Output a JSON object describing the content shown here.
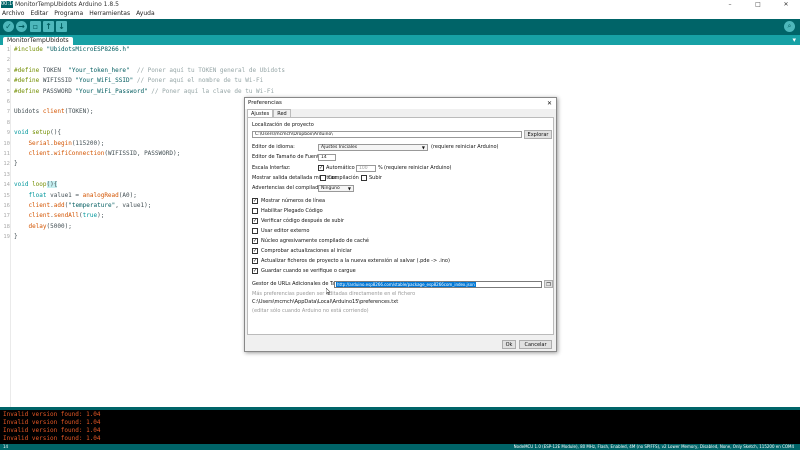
{
  "window": {
    "app_badge": "00:16",
    "title": "MonitorTempUbidots Arduino 1.8.5",
    "min_glyph": "–",
    "max_glyph": "□",
    "close_glyph": "✕"
  },
  "menu": [
    "Archivo",
    "Editar",
    "Programa",
    "Herramientas",
    "Ayuda"
  ],
  "toolbar": {
    "verify_icon": "check-icon",
    "upload_icon": "arrow-right-icon",
    "new_icon": "new-file-icon",
    "open_icon": "open-icon",
    "save_icon": "save-icon",
    "serial_icon": "magnifier-icon"
  },
  "tab": {
    "label": "MonitorTempUbidots",
    "menu_glyph": "▾"
  },
  "code": {
    "l1a": "#include ",
    "l1b": "\"UbidotsMicroESP8266.h\"",
    "l3a": "#define ",
    "l3b": "TOKEN  ",
    "l3c": "\"Your_token_here\"",
    "l3d": "  // Poner aquí tu TOKEN general de Ubidots",
    "l4a": "#define ",
    "l4b": "WIFISSID ",
    "l4c": "\"Your_WiFi_SSID\"",
    "l4d": " // Poner aquí el nombre de tu Wi-Fi",
    "l5a": "#define ",
    "l5b": "PASSWORD ",
    "l5c": "\"Your_WiFi_Password\"",
    "l5d": " // Poner aquí la clave de tu Wi-Fi",
    "l7a": "Ubidots ",
    "l7b": "client",
    "l7c": "(TOKEN);",
    "l9a": "void ",
    "l9b": "setup",
    "l9c": "(){",
    "l10a": "    Serial",
    "l10b": ".",
    "l10c": "begin",
    "l10d": "(115200);",
    "l11a": "    client",
    "l11b": ".",
    "l11c": "wifiConnection",
    "l11d": "(WIFISSID, PASSWORD);",
    "l12": "}",
    "l14a": "void ",
    "l14b": "loop",
    "l14c": "(){",
    "l15a": "    float ",
    "l15b": "value1 = ",
    "l15c": "analogRead",
    "l15d": "(A0);",
    "l16a": "    client",
    "l16b": ".",
    "l16c": "add",
    "l16d": "(",
    "l16e": "\"temperature\"",
    "l16f": ", value1);",
    "l17a": "    client",
    "l17b": ".",
    "l17c": "sendAll",
    "l17d": "(",
    "l17e": "true",
    "l17f": ");",
    "l18a": "    ",
    "l18b": "delay",
    "l18c": "(5000);",
    "l19": "}",
    "line_numbers": [
      "1",
      "2",
      "3",
      "4",
      "5",
      "6",
      "7",
      "8",
      "9",
      "10",
      "11",
      "12",
      "13",
      "14",
      "15",
      "16",
      "17",
      "18",
      "19"
    ]
  },
  "console": {
    "lines": [
      "Invalid version found: 1.04",
      "Invalid version found: 1.04",
      "Invalid version found: 1.04",
      "Invalid version found: 1.04"
    ]
  },
  "status": {
    "line": "14",
    "board": "NodeMCU 1.0 (ESP-12E Module), 80 MHz, Flash, Enabled, 4M (no SPIFFS), v2 Lower Memory, Disabled, None, Only Sketch, 115200 en COM4"
  },
  "dialog": {
    "title": "Preferencias",
    "close_glyph": "✕",
    "tabs": [
      "Ajustes",
      "Red"
    ],
    "sketchbook_label": "Localización de proyecto",
    "sketchbook_path": "C:\\Users\\mcmch\\Dropbox\\Arduino\\",
    "browse_label": "Explorar",
    "language_label": "Editor de idioma:",
    "language_value": "Ajustes Iniciales",
    "language_note": "(requiere reiniciar Arduino)",
    "fontsize_label": "Editor de Tamaño de Fuente:",
    "fontsize_value": "14",
    "scale_label": "Escala Interfaz:",
    "scale_auto_label": "Automático",
    "scale_value": "100",
    "scale_pct": "%",
    "scale_note": "(requiere reiniciar Arduino)",
    "verbose_label": "Mostrar salida detallada mientras:",
    "verbose_compile": "Compilación",
    "verbose_upload": "Subir",
    "warnings_label": "Advertencias del compilador:",
    "warnings_value": "Ninguno",
    "checks": [
      {
        "label": "Mostrar números de línea",
        "checked": true
      },
      {
        "label": "Habilitar Plegado Código",
        "checked": false
      },
      {
        "label": "Verificar código después de subir",
        "checked": true
      },
      {
        "label": "Usar editor externo",
        "checked": false
      },
      {
        "label": "Núcleo agresivamente compilado de caché",
        "checked": true
      },
      {
        "label": "Comprobar actualizaciones al iniciar",
        "checked": true
      },
      {
        "label": "Actualizar ficheros de proyecto a la nueva extensión al salvar (.pde -> .ino)",
        "checked": true
      },
      {
        "label": "Guardar cuando se verifique o cargue",
        "checked": true
      }
    ],
    "check_glyph": "✓",
    "urls_label": "Gestor de URLs Adicionales de Tarjetas:",
    "urls_value": "http://arduino.esp8266.com/stable/package_esp8266com_index.json",
    "more_prefs_note": "Más preferencias pueden ser editadas directamente en el fichero",
    "prefs_path": "C:\\Users\\mcmch\\AppData\\Local\\Arduino15\\preferences.txt",
    "edit_note": "(editar sólo cuando Arduino no está corriendo)",
    "ok_label": "Ok",
    "cancel_label": "Cancelar"
  },
  "colors": {
    "arduino_teal": "#006468",
    "tab_strip": "#17a1a5",
    "console_error": "#e65826",
    "selection_blue": "#0078d7"
  }
}
